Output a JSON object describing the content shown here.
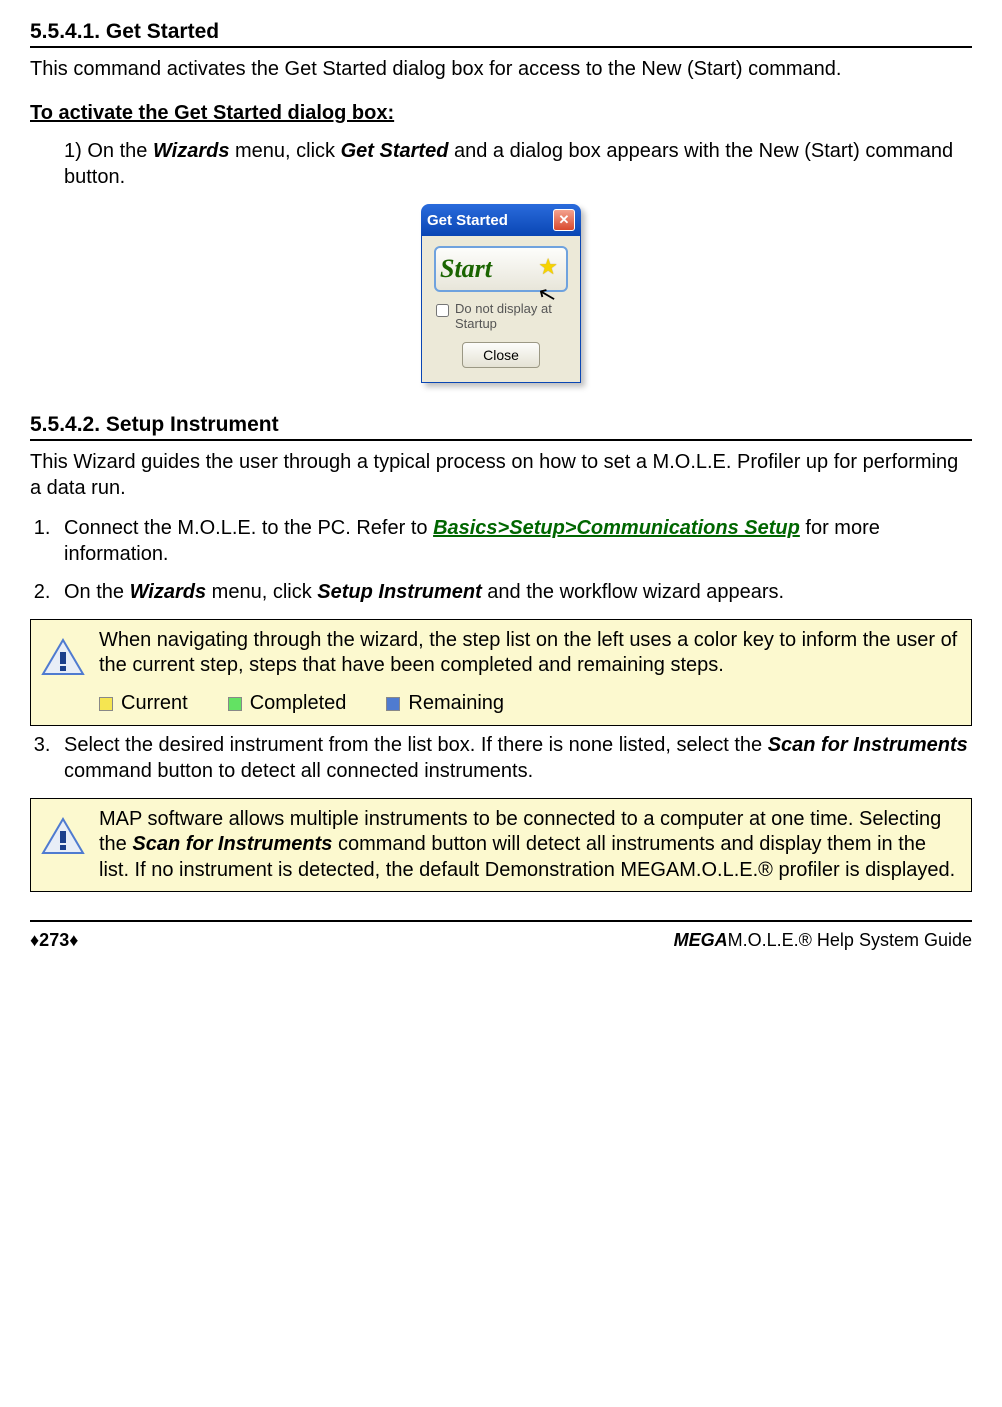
{
  "section1": {
    "number": "5.5.4.1. Get Started",
    "intro": "This command activates the Get Started dialog box for access to the New (Start) command.",
    "subhead": "To activate the Get Started dialog box:",
    "step1_pre": "1)  On the ",
    "step1_w": "Wizards",
    "step1_mid": " menu, click ",
    "step1_gs": "Get Started",
    "step1_post": " and a dialog box appears with the New (Start) command button."
  },
  "dialog": {
    "title": "Get Started",
    "start": "Start",
    "checkbox": "Do not display at Startup",
    "close": "Close"
  },
  "section2": {
    "number": "5.5.4.2. Setup Instrument",
    "intro": "This Wizard guides the user through a typical process on how to set a M.O.L.E. Profiler up for performing a data run.",
    "step1_pre": "Connect the M.O.L.E. to the PC. Refer to ",
    "step1_link": "Basics>Setup>Communications Setup",
    "step1_post": " for more information.",
    "step2_pre": "On the ",
    "step2_w": "Wizards",
    "step2_mid": " menu, click ",
    "step2_si": "Setup Instrument",
    "step2_post": " and the workflow wizard appears.",
    "step3_pre": "Select the desired instrument from the list box. If there is none listed, select the ",
    "step3_sfi": "Scan for Instruments",
    "step3_post": " command button to detect all connected instruments."
  },
  "note1": {
    "text": "When navigating through the wizard, the step list on the left uses a color key to inform the user of the current step, steps that have been completed and remaining steps.",
    "legend": {
      "current": {
        "label": "Current",
        "color": "#f5e551"
      },
      "completed": {
        "label": "Completed",
        "color": "#63e263"
      },
      "remaining": {
        "label": "Remaining",
        "color": "#4f7bd0"
      }
    }
  },
  "note2": {
    "text_pre": "MAP software allows multiple instruments to be connected to a computer at one time. Selecting the ",
    "text_sfi": "Scan for Instruments",
    "text_post": " command button will detect all instruments and display them in the list. If no instrument is detected, the default Demonstration MEGAM.O.L.E.® profiler is displayed."
  },
  "footer": {
    "page": "♦273♦",
    "title_mega": "MEGA",
    "title_rest": "M.O.L.E.® Help System Guide"
  }
}
